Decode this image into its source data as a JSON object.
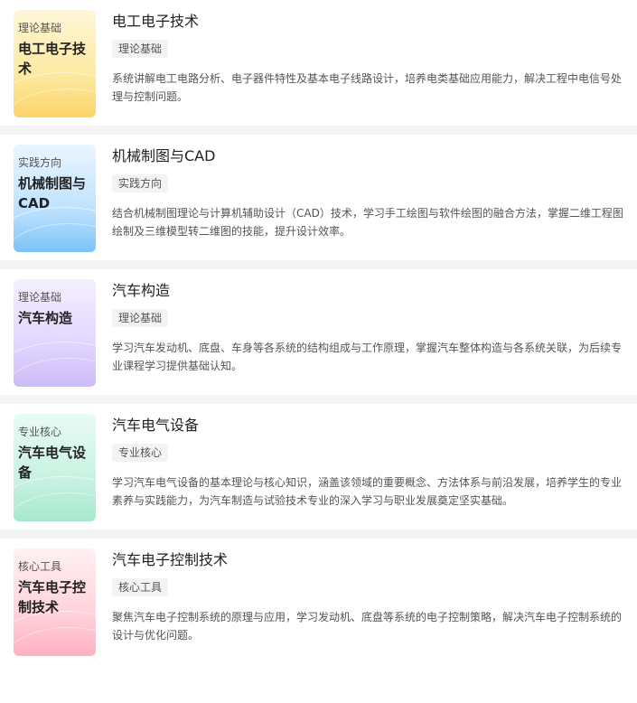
{
  "courses": [
    {
      "thumb_tag": "理论基础",
      "thumb_title": "电工电子技术",
      "title": "电工电子技术",
      "tag": "理论基础",
      "description": "系统讲解电工电路分析、电子器件特性及基本电子线路设计，培养电类基础应用能力，解决工程中电信号处理与控制问题。",
      "color": "#fbd46a"
    },
    {
      "thumb_tag": "实践方向",
      "thumb_title": "机械制图与CAD",
      "title": "机械制图与CAD",
      "tag": "实践方向",
      "description": "结合机械制图理论与计算机辅助设计（CAD）技术，学习手工绘图与软件绘图的融合方法，掌握二维工程图绘制及三维模型转二维图的技能，提升设计效率。",
      "color": "#7cc3f6"
    },
    {
      "thumb_tag": "理论基础",
      "thumb_title": "汽车构造",
      "title": "汽车构造",
      "tag": "理论基础",
      "description": "学习汽车发动机、底盘、车身等各系统的结构组成与工作原理，掌握汽车整体构造与各系统关联，为后续专业课程学习提供基础认知。",
      "color": "#cdbcf7"
    },
    {
      "thumb_tag": "专业核心",
      "thumb_title": "汽车电气设备",
      "title": "汽车电气设备",
      "tag": "专业核心",
      "description": "学习汽车电气设备的基本理论与核心知识，涵盖该领域的重要概念、方法体系与前沿发展，培养学生的专业素养与实践能力，为汽车制造与试验技术专业的深入学习与职业发展奠定坚实基础。",
      "color": "#a8e8cf"
    },
    {
      "thumb_tag": "核心工具",
      "thumb_title": "汽车电子控制技术",
      "title": "汽车电子控制技术",
      "tag": "核心工具",
      "description": "聚焦汽车电子控制系统的原理与应用，学习发动机、底盘等系统的电子控制策略，解决汽车电子控制系统的设计与优化问题。",
      "color": "#ffb0c0"
    }
  ]
}
